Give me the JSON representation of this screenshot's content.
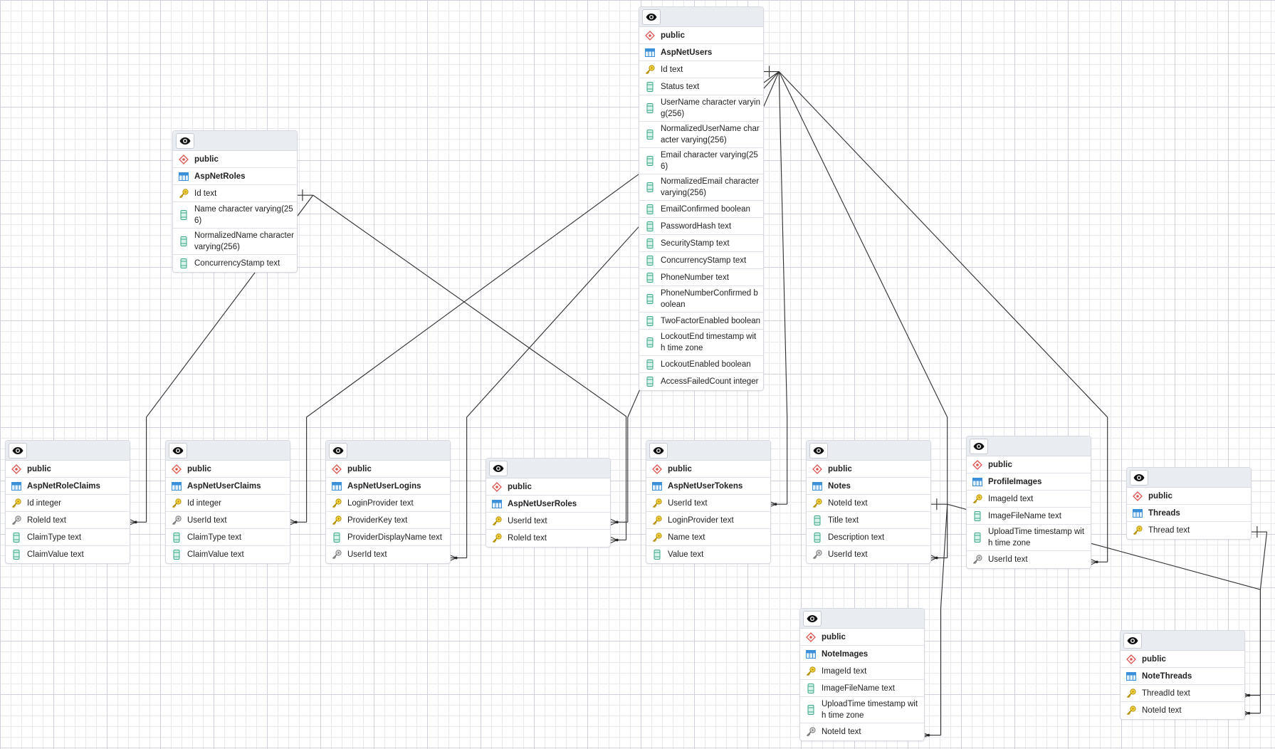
{
  "icons": {
    "view": "eye-icon",
    "schema": "schema-diamond-icon",
    "table": "table-grid-icon",
    "pk": "primary-key-icon",
    "fk": "foreign-key-icon",
    "col": "column-icon"
  },
  "colors": {
    "schema": "#d9534f",
    "table": "#3b8fd9",
    "pk": "#e0b400",
    "fk": "#8a8a8a",
    "col": "#3aa88a",
    "line": "#333333"
  },
  "tables": [
    {
      "schema": "public",
      "name": "AspNetUsers",
      "columns": [
        {
          "label": "Id text",
          "kind": "pk"
        },
        {
          "label": "Status text",
          "kind": "col"
        },
        {
          "label": "UserName character varying(256)",
          "kind": "col"
        },
        {
          "label": "NormalizedUserName character varying(256)",
          "kind": "col"
        },
        {
          "label": "Email character varying(256)",
          "kind": "col"
        },
        {
          "label": "NormalizedEmail character varying(256)",
          "kind": "col"
        },
        {
          "label": "EmailConfirmed boolean",
          "kind": "col"
        },
        {
          "label": "PasswordHash text",
          "kind": "col"
        },
        {
          "label": "SecurityStamp text",
          "kind": "col"
        },
        {
          "label": "ConcurrencyStamp text",
          "kind": "col"
        },
        {
          "label": "PhoneNumber text",
          "kind": "col"
        },
        {
          "label": "PhoneNumberConfirmed boolean",
          "kind": "col"
        },
        {
          "label": "TwoFactorEnabled boolean",
          "kind": "col"
        },
        {
          "label": "LockoutEnd timestamp with time zone",
          "kind": "col"
        },
        {
          "label": "LockoutEnabled boolean",
          "kind": "col"
        },
        {
          "label": "AccessFailedCount integer",
          "kind": "col"
        }
      ]
    },
    {
      "schema": "public",
      "name": "AspNetRoles",
      "columns": [
        {
          "label": "Id text",
          "kind": "pk"
        },
        {
          "label": "Name character varying(256)",
          "kind": "col"
        },
        {
          "label": "NormalizedName character varying(256)",
          "kind": "col"
        },
        {
          "label": "ConcurrencyStamp text",
          "kind": "col"
        }
      ]
    },
    {
      "schema": "public",
      "name": "AspNetRoleClaims",
      "columns": [
        {
          "label": "Id integer",
          "kind": "pk"
        },
        {
          "label": "RoleId text",
          "kind": "fk"
        },
        {
          "label": "ClaimType text",
          "kind": "col"
        },
        {
          "label": "ClaimValue text",
          "kind": "col"
        }
      ]
    },
    {
      "schema": "public",
      "name": "AspNetUserClaims",
      "columns": [
        {
          "label": "Id integer",
          "kind": "pk"
        },
        {
          "label": "UserId text",
          "kind": "fk"
        },
        {
          "label": "ClaimType text",
          "kind": "col"
        },
        {
          "label": "ClaimValue text",
          "kind": "col"
        }
      ]
    },
    {
      "schema": "public",
      "name": "AspNetUserLogins",
      "columns": [
        {
          "label": "LoginProvider text",
          "kind": "pk"
        },
        {
          "label": "ProviderKey text",
          "kind": "pk"
        },
        {
          "label": "ProviderDisplayName text",
          "kind": "col"
        },
        {
          "label": "UserId text",
          "kind": "fk"
        }
      ]
    },
    {
      "schema": "public",
      "name": "AspNetUserRoles",
      "columns": [
        {
          "label": "UserId text",
          "kind": "pk"
        },
        {
          "label": "RoleId text",
          "kind": "pk"
        }
      ]
    },
    {
      "schema": "public",
      "name": "AspNetUserTokens",
      "columns": [
        {
          "label": "UserId text",
          "kind": "pk"
        },
        {
          "label": "LoginProvider text",
          "kind": "pk"
        },
        {
          "label": "Name text",
          "kind": "pk"
        },
        {
          "label": "Value text",
          "kind": "col"
        }
      ]
    },
    {
      "schema": "public",
      "name": "Notes",
      "columns": [
        {
          "label": "NoteId text",
          "kind": "pk"
        },
        {
          "label": "Title text",
          "kind": "col"
        },
        {
          "label": "Description text",
          "kind": "col"
        },
        {
          "label": "UserId text",
          "kind": "fk"
        }
      ]
    },
    {
      "schema": "public",
      "name": "ProfileImages",
      "columns": [
        {
          "label": "ImageId text",
          "kind": "pk"
        },
        {
          "label": "ImageFileName text",
          "kind": "col"
        },
        {
          "label": "UploadTime timestamp with time zone",
          "kind": "col"
        },
        {
          "label": "UserId text",
          "kind": "fk"
        }
      ]
    },
    {
      "schema": "public",
      "name": "Threads",
      "columns": [
        {
          "label": "Thread text",
          "kind": "pk"
        }
      ]
    },
    {
      "schema": "public",
      "name": "NoteImages",
      "columns": [
        {
          "label": "ImageId text",
          "kind": "pk"
        },
        {
          "label": "ImageFileName text",
          "kind": "col"
        },
        {
          "label": "UploadTime timestamp with time zone",
          "kind": "col"
        },
        {
          "label": "NoteId text",
          "kind": "fk"
        }
      ]
    },
    {
      "schema": "public",
      "name": "NoteThreads",
      "columns": [
        {
          "label": "ThreadId text",
          "kind": "pk"
        },
        {
          "label": "NoteId text",
          "kind": "pk"
        }
      ]
    }
  ],
  "relationships": [
    {
      "from": "AspNetRoles.Id",
      "to": "AspNetRoleClaims.RoleId",
      "cardinality": "one-to-many"
    },
    {
      "from": "AspNetRoles.Id",
      "to": "AspNetUserRoles.RoleId",
      "cardinality": "one-to-many"
    },
    {
      "from": "AspNetUsers.Id",
      "to": "AspNetUserClaims.UserId",
      "cardinality": "one-to-many"
    },
    {
      "from": "AspNetUsers.Id",
      "to": "AspNetUserLogins.UserId",
      "cardinality": "one-to-many"
    },
    {
      "from": "AspNetUsers.Id",
      "to": "AspNetUserRoles.UserId",
      "cardinality": "one-to-many"
    },
    {
      "from": "AspNetUsers.Id",
      "to": "AspNetUserTokens.UserId",
      "cardinality": "one-to-many"
    },
    {
      "from": "AspNetUsers.Id",
      "to": "Notes.UserId",
      "cardinality": "one-to-many"
    },
    {
      "from": "AspNetUsers.Id",
      "to": "ProfileImages.UserId",
      "cardinality": "one-to-many"
    },
    {
      "from": "Notes.NoteId",
      "to": "NoteImages.NoteId",
      "cardinality": "one-to-many"
    },
    {
      "from": "Notes.NoteId",
      "to": "NoteThreads.NoteId",
      "cardinality": "one-to-many"
    },
    {
      "from": "Threads.Thread",
      "to": "NoteThreads.ThreadId",
      "cardinality": "one-to-many"
    }
  ]
}
